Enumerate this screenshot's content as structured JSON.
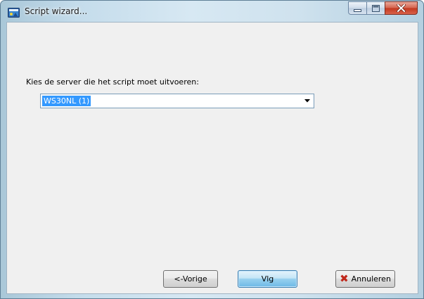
{
  "window": {
    "title": "Script wizard...",
    "caption_buttons": {
      "minimize_icon": "minimize-icon",
      "maximize_icon": "maximize-icon",
      "close_icon": "close-icon"
    },
    "app_icon": "wizard-app-icon"
  },
  "form": {
    "server_prompt": "Kies de server die het script moet uitvoeren:",
    "server_select": {
      "selected": "WS30NL  (1)",
      "arrow_icon": "chevron-down-icon"
    }
  },
  "footer": {
    "prev_label": "<-Vorige",
    "next_label": "Vlg",
    "cancel_label": "Annuleren",
    "cancel_icon": "cancel-x-icon"
  },
  "colors": {
    "selection": "#3399ff",
    "default_button": "#98d1ef",
    "close_button": "#c2381f",
    "cancel_icon": "#c0281c"
  }
}
